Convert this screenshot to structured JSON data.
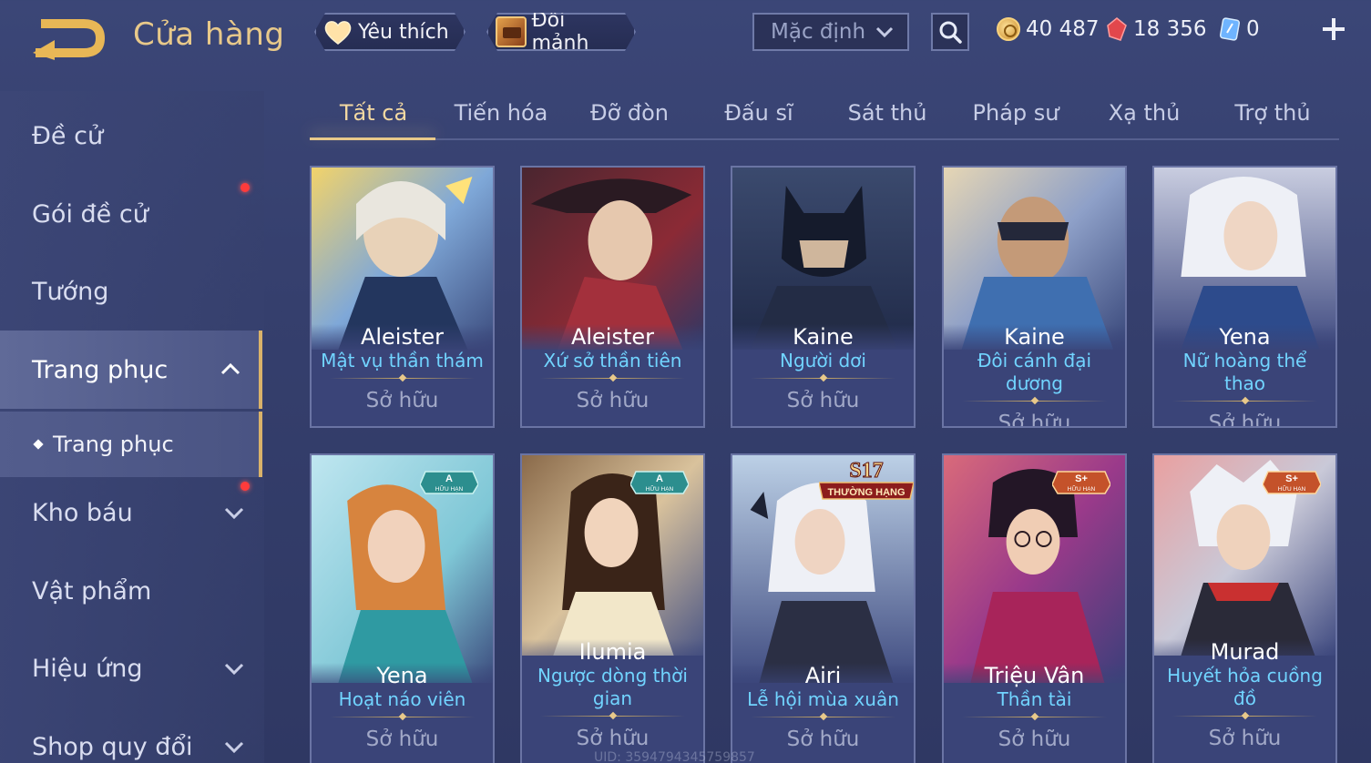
{
  "header": {
    "title": "Cửa hàng",
    "favorites_label": "Yêu thích",
    "shard_label": "Đổi mảnh",
    "sort_value": "Mặc định",
    "gold": "40 487",
    "voucher": "18 356",
    "crystal": "0"
  },
  "sidebar": {
    "items": [
      {
        "label": "Đề cử"
      },
      {
        "label": "Gói đề cử"
      },
      {
        "label": "Tướng"
      },
      {
        "label": "Trang phục"
      },
      {
        "label": "Trang phục"
      },
      {
        "label": "Kho báu"
      },
      {
        "label": "Vật phẩm"
      },
      {
        "label": "Hiệu ứng"
      },
      {
        "label": "Shop quy đổi"
      }
    ]
  },
  "tabs": [
    "Tất cả",
    "Tiến hóa",
    "Đỡ đòn",
    "Đấu sĩ",
    "Sát thủ",
    "Pháp sư",
    "Xạ thủ",
    "Trợ thủ"
  ],
  "cards": [
    {
      "hero": "Aleister",
      "skin": "Mật vụ thần thám",
      "status": "Sở hữu"
    },
    {
      "hero": "Aleister",
      "skin": "Xứ sở thần tiên",
      "status": "Sở hữu"
    },
    {
      "hero": "Kaine",
      "skin": "Người dơi",
      "status": "Sở hữu"
    },
    {
      "hero": "Kaine",
      "skin": "Đôi cánh đại dương",
      "status": "Sở hữu"
    },
    {
      "hero": "Yena",
      "skin": "Nữ hoàng thể thao",
      "status": "Sở hữu"
    },
    {
      "hero": "Yena",
      "skin": "Hoạt náo viên",
      "status": "Sở hữu",
      "badge": "A"
    },
    {
      "hero": "Ilumia",
      "skin": "Ngược dòng thời gian",
      "status": "Sở hữu",
      "badge": "A"
    },
    {
      "hero": "Airi",
      "skin": "Lễ hội mùa xuân",
      "status": "Sở hữu",
      "rank": "S17",
      "rank_label": "THƯỜNG HẠNG"
    },
    {
      "hero": "Triệu Vân",
      "skin": "Thần tài",
      "status": "Sở hữu",
      "badge": "S+"
    },
    {
      "hero": "Murad",
      "skin": "Huyết hỏa cuồng đồ",
      "status": "Sở hữu",
      "badge": "S+"
    }
  ],
  "badge_sub": "HỮU HẠN",
  "uid": "UID: 3594794345759857",
  "colors": {
    "accent_gold": "#e8c98a",
    "skin_blue": "#71d4ff",
    "notify_red": "#ff3b3b"
  }
}
